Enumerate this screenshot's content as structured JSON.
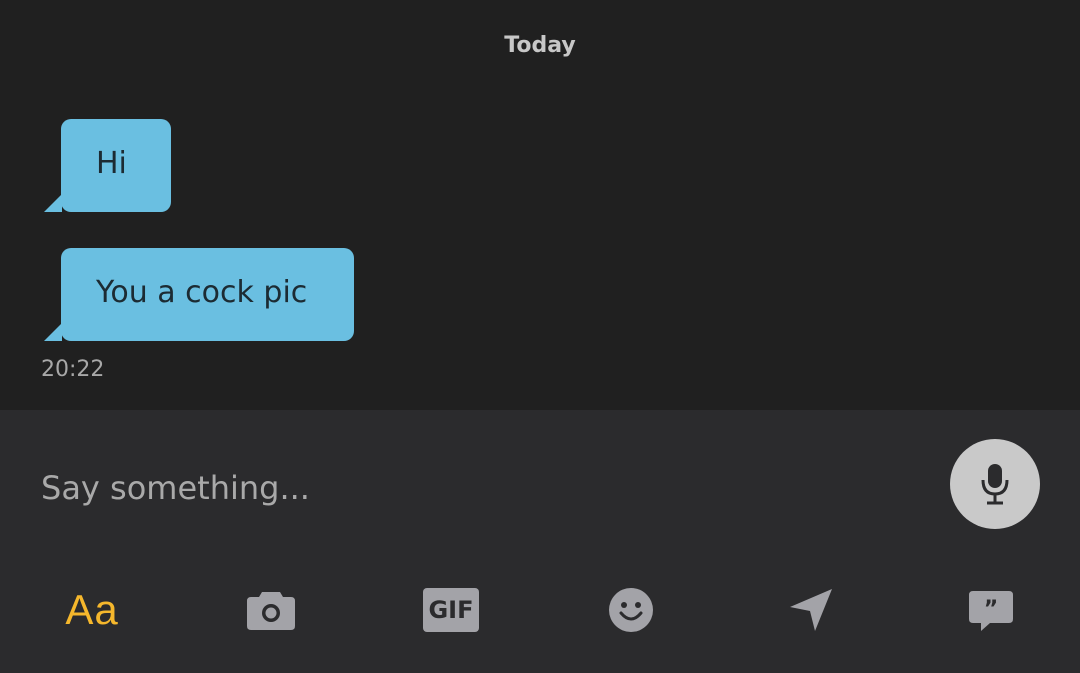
{
  "chat": {
    "date_divider": "Today",
    "messages": [
      {
        "text": "Hi"
      },
      {
        "text": "You a cock pic"
      }
    ],
    "timestamp": "20:22"
  },
  "composer": {
    "placeholder": "Say something...",
    "toolbar": {
      "text_style_label": "Aa",
      "gif_label": "GIF",
      "icons": [
        "microphone-icon",
        "camera-icon",
        "gif-icon",
        "smiley-icon",
        "location-arrow-icon",
        "saved-phrases-icon"
      ]
    }
  },
  "colors": {
    "background": "#202020",
    "composer_background": "#2b2b2d",
    "bubble": "#6abfe1",
    "accent": "#f5b72c",
    "icon": "#a3a3a8"
  }
}
